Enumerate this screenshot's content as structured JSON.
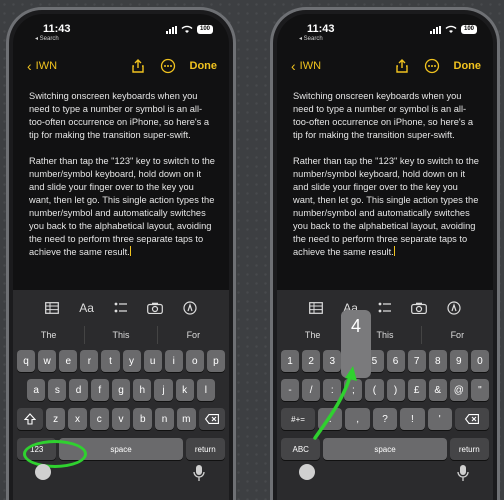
{
  "left_phone": {
    "status": {
      "time": "11:43",
      "back_app": "◂ Search",
      "battery": "100"
    },
    "nav": {
      "back_label": "IWN",
      "done": "Done"
    },
    "notes": {
      "p1": "Switching onscreen keyboards when you need to type a number or symbol is an all-too-often occurrence on iPhone, so here's a tip for making the transition super-swift.",
      "p2": "Rather than tap the \"123\" key to switch to the number/symbol keyboard, hold down on it and slide your finger over to the key you want, then let go. This single action types the number/symbol and automatically switches you back to the alphabetical layout, avoiding the need to perform three separate taps to achieve the same result."
    },
    "toolbar": {
      "format_label": "Aa"
    },
    "predictions": [
      "The",
      "This",
      "For"
    ],
    "rows": {
      "row1": [
        "q",
        "w",
        "e",
        "r",
        "t",
        "y",
        "u",
        "i",
        "o",
        "p"
      ],
      "row2": [
        "a",
        "s",
        "d",
        "f",
        "g",
        "h",
        "j",
        "k",
        "l"
      ],
      "row3": [
        "z",
        "x",
        "c",
        "v",
        "b",
        "n",
        "m"
      ]
    },
    "bottom": {
      "numbers": "123",
      "space": "space",
      "return": "return"
    }
  },
  "right_phone": {
    "status": {
      "time": "11:43",
      "back_app": "◂ Search",
      "battery": "100"
    },
    "nav": {
      "back_label": "IWN",
      "done": "Done"
    },
    "notes": {
      "p1": "Switching onscreen keyboards when you need to type a number or symbol is an all-too-often occurrence on iPhone, so here's a tip for making the transition super-swift.",
      "p2": "Rather than tap the \"123\" key to switch to the number/symbol keyboard, hold down on it and slide your finger over to the key you want, then let go. This single action types the number/symbol and automatically switches you back to the alphabetical layout, avoiding the need to perform three separate taps to achieve the same result."
    },
    "toolbar": {
      "format_label": "Aa"
    },
    "predictions": [
      "The",
      "This",
      "For"
    ],
    "popup_key": "4",
    "rows": {
      "row1": [
        "1",
        "2",
        "3",
        "4",
        "5",
        "6",
        "7",
        "8",
        "9",
        "0"
      ],
      "row2": [
        "-",
        "/",
        ":",
        ";",
        "(",
        ")",
        "£",
        "&",
        "@",
        "\""
      ],
      "row3": [
        "#+=",
        ".",
        ",",
        "?",
        "!",
        "'"
      ]
    },
    "bottom": {
      "letters": "ABC",
      "space": "space",
      "return": "return"
    }
  },
  "colors": {
    "accent": "#f1c31f",
    "annotation": "#2fd12f"
  },
  "icons": [
    "table-icon",
    "checklist-icon",
    "camera-icon",
    "markup-icon",
    "share-icon",
    "more-icon",
    "emoji-icon",
    "mic-icon",
    "delete-icon",
    "shift-icon"
  ]
}
